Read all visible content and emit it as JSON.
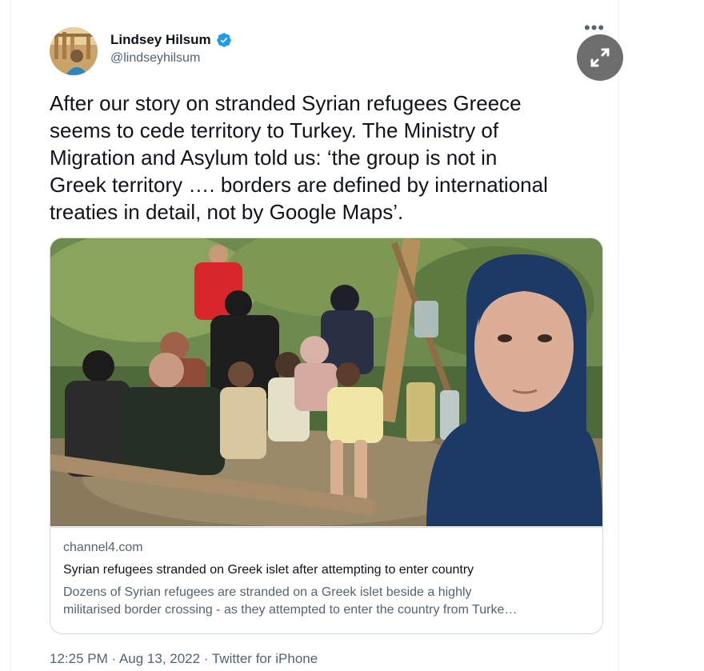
{
  "author": {
    "name": "Lindsey Hilsum",
    "handle": "@lindseyhilsum",
    "verified": true
  },
  "icons": {
    "verified": "verified-badge-icon",
    "more": "more-options-icon",
    "expand": "expand-icon"
  },
  "tweet": {
    "text": "After our story on stranded Syrian refugees Greece\nseems to cede territory to Turkey. The Ministry of\nMigration and Asylum told us: ‘the group is not in\nGreek territory …. borders are defined by international\ntreaties in detail, not by Google Maps’."
  },
  "card": {
    "domain": "channel4.com",
    "title": "Syrian refugees stranded on Greek islet after attempting to enter country",
    "description": "Dozens of Syrian refugees are stranded on a Greek islet beside a highly\nmilitarised border crossing - as they attempted to enter the country from Turke…"
  },
  "meta": {
    "time": "12:25 PM",
    "separator1": " · ",
    "date": "Aug 13, 2022",
    "separator2": " · ",
    "source": "Twitter for iPhone"
  },
  "colors": {
    "verified": "#1d9bf0",
    "secondary_text": "#536471",
    "border": "#cfd9de"
  }
}
